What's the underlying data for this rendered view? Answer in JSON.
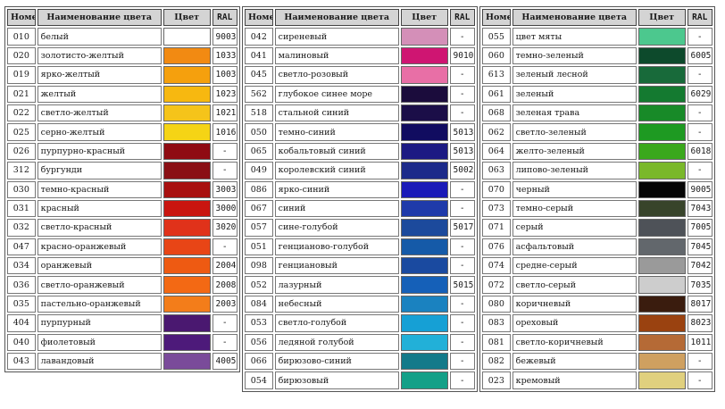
{
  "headers": {
    "num": "Номер",
    "name": "Наименование цвета",
    "color": "Цвет",
    "ral": "RAL"
  },
  "columns": [
    {
      "rows": [
        {
          "num": "010",
          "name": "белый",
          "color": "#ffffff",
          "ral": "9003"
        },
        {
          "num": "020",
          "name": "золотисто-желтый",
          "color": "#f28a12",
          "ral": "1033"
        },
        {
          "num": "019",
          "name": "ярко-желтый",
          "color": "#f5a00d",
          "ral": "1003"
        },
        {
          "num": "021",
          "name": "желтый",
          "color": "#f7b810",
          "ral": "1023"
        },
        {
          "num": "022",
          "name": "светло-желтый",
          "color": "#f5c41a",
          "ral": "1021"
        },
        {
          "num": "025",
          "name": "серно-желтый",
          "color": "#f5d415",
          "ral": "1016"
        },
        {
          "num": "026",
          "name": "пурпурно-красный",
          "color": "#8f0b12",
          "ral": "-"
        },
        {
          "num": "312",
          "name": "бургунди",
          "color": "#8a0f14",
          "ral": "-"
        },
        {
          "num": "030",
          "name": "темно-красный",
          "color": "#a8100f",
          "ral": "3003"
        },
        {
          "num": "031",
          "name": "красный",
          "color": "#c9150f",
          "ral": "3000"
        },
        {
          "num": "032",
          "name": "светло-красный",
          "color": "#e0321a",
          "ral": "3020"
        },
        {
          "num": "047",
          "name": "красно-оранжевый",
          "color": "#e84516",
          "ral": "-"
        },
        {
          "num": "034",
          "name": "оранжевый",
          "color": "#ee5a12",
          "ral": "2004"
        },
        {
          "num": "036",
          "name": "светло-оранжевый",
          "color": "#f36914",
          "ral": "2008"
        },
        {
          "num": "035",
          "name": "пастельно-оранжевый",
          "color": "#f37d1a",
          "ral": "2003"
        },
        {
          "num": "404",
          "name": "пурпурный",
          "color": "#4a1870",
          "ral": "-"
        },
        {
          "num": "040",
          "name": "фиолетовый",
          "color": "#4d1a7a",
          "ral": "-"
        },
        {
          "num": "043",
          "name": "лавандовый",
          "color": "#7a4b9a",
          "ral": "4005"
        }
      ]
    },
    {
      "rows": [
        {
          "num": "042",
          "name": "сиреневый",
          "color": "#d48fb8",
          "ral": "-"
        },
        {
          "num": "041",
          "name": "малиновый",
          "color": "#cf1572",
          "ral": "9010"
        },
        {
          "num": "045",
          "name": "светло-розовый",
          "color": "#e86fa6",
          "ral": "-"
        },
        {
          "num": "562",
          "name": "глубокое синее море",
          "color": "#1b0c3c",
          "ral": "-"
        },
        {
          "num": "518",
          "name": "стальной синий",
          "color": "#1b0e48",
          "ral": "-"
        },
        {
          "num": "050",
          "name": "темно-синий",
          "color": "#110c60",
          "ral": "5013"
        },
        {
          "num": "065",
          "name": "кобальтовый синий",
          "color": "#1c1a83",
          "ral": "5013"
        },
        {
          "num": "049",
          "name": "королевский синий",
          "color": "#1c2a8a",
          "ral": "5002"
        },
        {
          "num": "086",
          "name": "ярко-синий",
          "color": "#1a1ab8",
          "ral": "-"
        },
        {
          "num": "067",
          "name": "синий",
          "color": "#1f3aaa",
          "ral": "-"
        },
        {
          "num": "057",
          "name": "сине-голубой",
          "color": "#1c4a9c",
          "ral": "5017"
        },
        {
          "num": "051",
          "name": "генцианово-голубой",
          "color": "#155aa8",
          "ral": "-"
        },
        {
          "num": "098",
          "name": "генциановый",
          "color": "#1a4aa0",
          "ral": "-"
        },
        {
          "num": "052",
          "name": "лазурный",
          "color": "#1560b8",
          "ral": "5015"
        },
        {
          "num": "084",
          "name": "небесный",
          "color": "#1a82c0",
          "ral": "-"
        },
        {
          "num": "053",
          "name": "светло-голубой",
          "color": "#16a0d5",
          "ral": "-"
        },
        {
          "num": "056",
          "name": "ледяной голубой",
          "color": "#22b0d8",
          "ral": "-"
        },
        {
          "num": "066",
          "name": "бирюзово-синий",
          "color": "#137a8a",
          "ral": "-"
        },
        {
          "num": "054",
          "name": "бирюзовый",
          "color": "#14a088",
          "ral": "-"
        }
      ]
    },
    {
      "rows": [
        {
          "num": "055",
          "name": "цвет мяты",
          "color": "#4cc88e",
          "ral": "-"
        },
        {
          "num": "060",
          "name": "темно-зеленый",
          "color": "#0d4a2c",
          "ral": "6005"
        },
        {
          "num": "613",
          "name": "зеленый лесной",
          "color": "#186a3a",
          "ral": "-"
        },
        {
          "num": "061",
          "name": "зеленый",
          "color": "#147a30",
          "ral": "6029"
        },
        {
          "num": "068",
          "name": "зеленая трава",
          "color": "#188a28",
          "ral": "-"
        },
        {
          "num": "062",
          "name": "светло-зеленый",
          "color": "#1e9a22",
          "ral": "-"
        },
        {
          "num": "064",
          "name": "желто-зеленый",
          "color": "#3aa81c",
          "ral": "6018"
        },
        {
          "num": "063",
          "name": "липово-зеленый",
          "color": "#7ab82a",
          "ral": "-"
        },
        {
          "num": "070",
          "name": "черный",
          "color": "#050505",
          "ral": "9005"
        },
        {
          "num": "073",
          "name": "темно-серый",
          "color": "#38442a",
          "ral": "7043"
        },
        {
          "num": "071",
          "name": "серый",
          "color": "#4e5258",
          "ral": "7005"
        },
        {
          "num": "076",
          "name": "асфальтовый",
          "color": "#62676c",
          "ral": "7045"
        },
        {
          "num": "074",
          "name": "средне-серый",
          "color": "#9a9a9a",
          "ral": "7042"
        },
        {
          "num": "072",
          "name": "светло-серый",
          "color": "#cdcdcd",
          "ral": "7035"
        },
        {
          "num": "080",
          "name": "коричневый",
          "color": "#3a1c0e",
          "ral": "8017"
        },
        {
          "num": "083",
          "name": "ореховый",
          "color": "#9a4210",
          "ral": "8023"
        },
        {
          "num": "081",
          "name": "светло-коричневый",
          "color": "#b56a36",
          "ral": "1011"
        },
        {
          "num": "082",
          "name": "бежевый",
          "color": "#cfa060",
          "ral": "-"
        },
        {
          "num": "023",
          "name": "кремовый",
          "color": "#e0d07e",
          "ral": "-"
        }
      ]
    }
  ]
}
